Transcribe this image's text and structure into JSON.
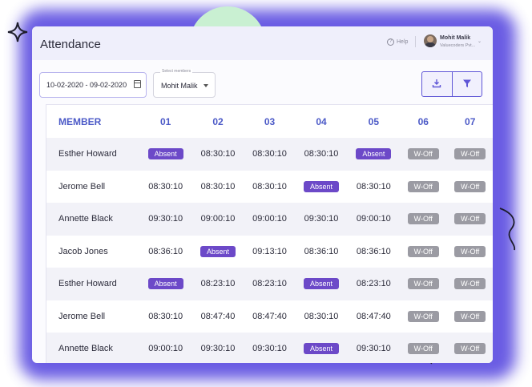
{
  "app": {
    "title": "Attendance"
  },
  "header": {
    "help_label": "Help",
    "user_name": "Mohit Malik",
    "user_org": "Valuecoders Pvt..."
  },
  "filters": {
    "date_range": "10-02-2020 - 09-02-2020",
    "member_legend": "Select members",
    "member_value": "Mohit Malik"
  },
  "table": {
    "columns": [
      "MEMBER",
      "01",
      "02",
      "03",
      "04",
      "05",
      "06",
      "07"
    ],
    "rows": [
      [
        "Esther Howard",
        "Absent",
        "08:30:10",
        "08:30:10",
        "08:30:10",
        "Absent",
        "W-Off",
        "W-Off"
      ],
      [
        "Jerome Bell",
        "08:30:10",
        "08:30:10",
        "08:30:10",
        "Absent",
        "08:30:10",
        "W-Off",
        "W-Off"
      ],
      [
        "Annette Black",
        "09:30:10",
        "09:00:10",
        "09:00:10",
        "09:30:10",
        "09:00:10",
        "W-Off",
        "W-Off"
      ],
      [
        "Jacob Jones",
        "08:36:10",
        "Absent",
        "09:13:10",
        "08:36:10",
        "08:36:10",
        "W-Off",
        "W-Off"
      ],
      [
        "Esther Howard",
        "Absent",
        "08:23:10",
        "08:23:10",
        "Absent",
        "08:23:10",
        "W-Off",
        "W-Off"
      ],
      [
        "Jerome Bell",
        "08:30:10",
        "08:47:40",
        "08:47:40",
        "08:30:10",
        "08:47:40",
        "W-Off",
        "W-Off"
      ],
      [
        "Annette Black",
        "09:00:10",
        "09:30:10",
        "09:30:10",
        "Absent",
        "09:30:10",
        "W-Off",
        "W-Off"
      ]
    ]
  },
  "colors": {
    "accent": "#4b59c7",
    "absent_badge": "#6c49c8",
    "woff_badge": "#9b9ba3",
    "frame_glow": "#5a4be0"
  }
}
